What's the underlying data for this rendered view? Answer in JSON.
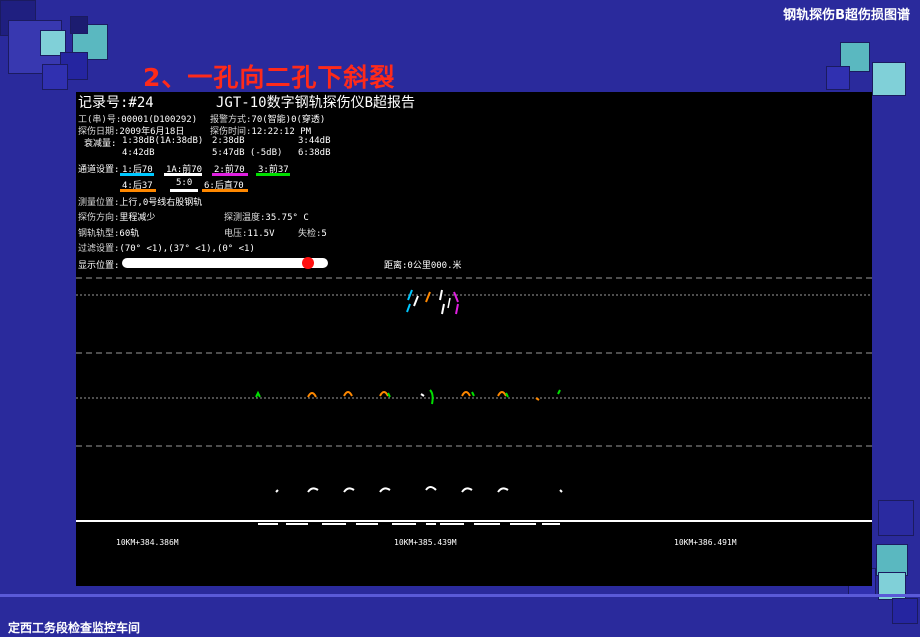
{
  "header": {
    "title": "钢轨探伤B超伤损图谱"
  },
  "slide": {
    "title": "2、一孔向二孔下斜裂"
  },
  "footer": {
    "text": "定西工务段检查监控车间"
  },
  "report": {
    "record_no": "记录号:#24",
    "device_title": "JGT-10数字钢轨探伤仪B超报告",
    "work_no_label": "工(串)号:",
    "work_no": "00001(D100292)",
    "alarm_label": "报警方式:",
    "alarm": "70(智能)0(穿透)",
    "date_label": "探伤日期:",
    "date": "2009年6月18日",
    "time_label": "探伤时间:",
    "time": "12:22:12 PM",
    "attenuation_label": "衰减量:",
    "att_row1": [
      "1:38dB(1A:38dB)",
      "2:38dB",
      "3:44dB"
    ],
    "att_row2": [
      "4:42dB",
      "5:47dB  (-5dB)",
      "6:38dB"
    ],
    "channel_label": "通道设置:",
    "channels_row1": [
      {
        "text": "1:后70",
        "color": "#00c8ff"
      },
      {
        "text": "1A:前70",
        "color": "#ffffff"
      },
      {
        "text": "2:前70",
        "color": "#e020e0"
      },
      {
        "text": "3:前37",
        "color": "#00e000"
      }
    ],
    "channels_row2": [
      {
        "text": "4:后37",
        "color": "#ff8800"
      },
      {
        "text": "5:0",
        "color": "#ffffff"
      },
      {
        "text": "6:后直70",
        "color": "#ff8800"
      }
    ],
    "location_label": "测量位置:",
    "location": "上行,0号线右股钢轨",
    "direction_label": "探伤方向:",
    "direction": "里程减少",
    "temp_label": "探测温度:",
    "temp": "35.75° C",
    "rail_label": "钢轨轨型:",
    "rail": "60轨",
    "voltage_label": "电压:",
    "voltage": "11.5V",
    "miss_label": "失检:",
    "miss": "5",
    "filter_label": "过滤设置:",
    "filter": "(70° <1),(37° <1),(0° <1)",
    "display_label": "显示位置:",
    "display_progress": 0.93,
    "distance": "距离:0公里000.米",
    "km_marks": [
      "10KM+384.386M",
      "10KM+385.439M",
      "10KM+386.491M"
    ]
  }
}
